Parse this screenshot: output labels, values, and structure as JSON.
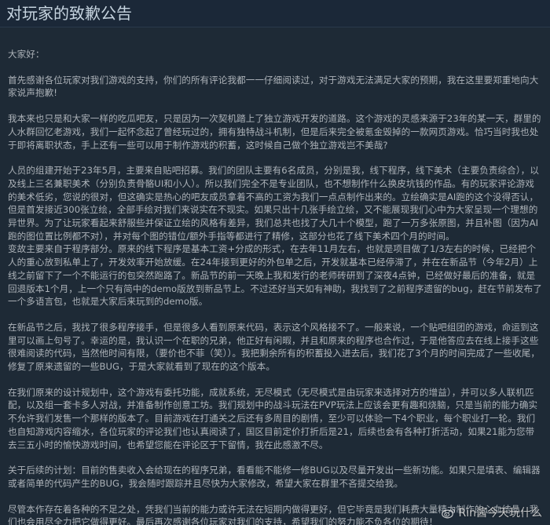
{
  "header": {
    "title": "对玩家的致歉公告"
  },
  "paragraphs": [
    "大家好：",
    "首先感谢各位玩家对我们游戏的支持，你们的所有评论我都一一仔细阅读过，对于游戏无法满足大家的预期，我在这里要郑重地向大家说声抱歉!",
    "我本来也只是和大家一样的吃瓜吧友，只是因为一次契机踏上了独立游戏开发的道路。这个游戏的灵感来源于23年的某一天，群里的人水群回忆老游戏，我们一起怀念起了曾经玩过的，拥有独特战斗机制，但是后来完全被氪金毁掉的一款网页游戏。恰巧当时我也处于即将离职状态，手上还有一些可以用于制作游戏的积蓄，这时候自己做个独立游戏岂不美哉?",
    "人员的组建开始于23年5月，主要来自贴吧招募。我们的团队主要有6名成员，分别是我，线下程序，线下美术（主要负责综合），以及线上三名兼职美术（分别负责骨骼UI和小人）。所以我们完全不是专业团队，也不想制作什么换皮坑钱的作品。有的玩家评论游戏的美术低劣，您说的很对，但这确实是热心的吧友成员拿着不高的工资为我们一点点制作出来的。立绘确实是AI跑的这个没得否认，但是首发接近300张立绘，全部手绘对我们来说实在不现实。如果只出十几张手绘立绘，又不能展现我们心中为大家呈现一个理想的异世界。为了让玩家看起来舒服些并保证立绘的风格有差异，我们总共也找了大几十个模型，跑了一万多张原图，并且补图（因为AI跑的图位置比例都不对），并对每个图的错位/额外手指等都进行了精修，这部分也花了线下美术四个月的时间。",
    "变故主要来自于程序部分。原来的线下程序是基本工资+分成的形式，在去年11月左右，也就是项目做了1/3左右的时候，已经把个人的重心放到私单上了，开发效率开始放缓。在24年接到更好的外包单之后，开发就基本已经停滞了，并在在新品节（今年2月）上线之前留下了一个不能运行的包突然跑路了。新品节的前一天晚上我和发行的老师砖研到了深夜4点钟，已经做好最后的准备，就是回退版本1个月，上一个只有简中的demo版放到新品节上。不过还好当天如有神助，我找到了之前程序遗留的bug，赶在节前发布了一个多语言包，也就是大家后来玩到的demo版。",
    "在新品节之后，我找了很多程序接手，但是很多人看到原来代码，表示这个风格接不了。一般来说，一个贴吧组团的游戏，命运到这里可以画上句号了。幸运的是，我认识一个在职的兄弟，他正好有闲暇，并且和原来的程序也合作过，于是他答应去在线上接手这些很难阅读的代码，当然他时间有限，（要价也不菲（笑））。我把剩余所有的积蓄投入进去后，我们花了3个月的时间完成了一些收尾，修复了原来遗留的一些BUG，于是大家就看到了现在的这个版本。",
    "在我们原来的设计规划中，这个游戏有委托功能，成就系统，无尽模式（无尽模式是由玩家来选择对方的增益），并可以多人联机匹配，以及组一套卡多人对战，并准备制作创意工坊。我们规划中的战斗玩法在PVP玩法上应该会更有趣和烧脑，只是当前的能力确实不允许我们发售一个那样的版本了。目前游戏在打通关之后还有多周目的剧情，至少可以体验一下4个职业，每个职业打一轮。我们也自知游戏内容缩水，各位玩家的评论我们也认真阅读了，国区目前定价打折后是21，后续也会有各种打折活动，如果21能为您带去三五小时的愉快游戏时间，也希望您能在评论区于下留情，我在此感激不尽。",
    "关于后续的计划：目前的售卖收入会给现在的程序兄弟，看看能不能修一修BUG以及尽量开发出一些新功能。如果只是填表、编辑器或者简单的代码产生的BUG，我会随时跟踪并且尽快为大家修改，希望大家在群里不吝提交给我。",
    "尽管本作存在着各种的不足之处，凭我们当前的能力或许无法在短期内做得更好，但它毕竟是我们耗费大量精力制作的心血结晶，我们也会用尽全力把它做得更好。最后再次感谢各位玩家对我们的支持，希望我们的努力能不负各位的期待！"
  ],
  "watermark": {
    "text": "Rin酱今天玩什么",
    "icon": "weibo-icon"
  },
  "colors": {
    "background": "#1b2838",
    "text": "#acb2b8",
    "title": "#c6d4df"
  }
}
